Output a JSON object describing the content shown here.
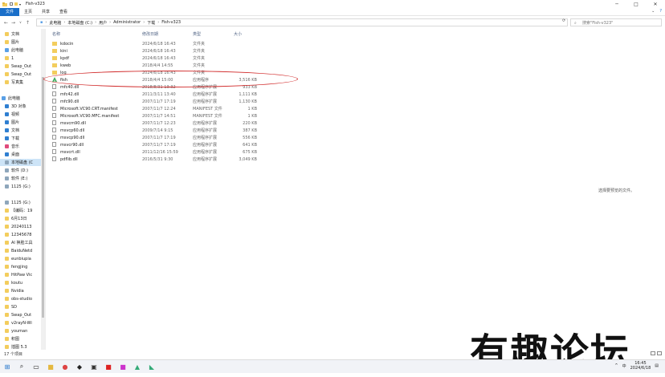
{
  "window": {
    "title": "Fish-v323",
    "controls": {
      "minimize": "─",
      "maximize": "□",
      "close": "✕"
    }
  },
  "ribbon": {
    "file_tab": "文件",
    "tabs": [
      "主页",
      "共享",
      "查看"
    ]
  },
  "address": {
    "crumbs": [
      "此电脑",
      "本地磁盘 (C:)",
      "用户",
      "Administrator",
      "下载",
      "Fish-v323"
    ],
    "search_placeholder": "搜索\"Fish-v323\""
  },
  "sidebar": {
    "items": [
      {
        "label": "文档",
        "icon": "folder"
      },
      {
        "label": "图片",
        "icon": "folder"
      },
      {
        "label": "此电脑",
        "icon": "pc"
      },
      {
        "label": "1",
        "icon": "folder"
      },
      {
        "label": "Swap_Out",
        "icon": "folder"
      },
      {
        "label": "Swap_Out",
        "icon": "folder"
      },
      {
        "label": "写真集",
        "icon": "folder"
      },
      {
        "label": "",
        "icon": ""
      },
      {
        "label": "此电脑",
        "icon": "pc"
      },
      {
        "label": "3D 对象",
        "icon": "blue"
      },
      {
        "label": "视频",
        "icon": "blue"
      },
      {
        "label": "图片",
        "icon": "blue"
      },
      {
        "label": "文档",
        "icon": "blue"
      },
      {
        "label": "下载",
        "icon": "blue"
      },
      {
        "label": "音乐",
        "icon": "music"
      },
      {
        "label": "桌面",
        "icon": "blue"
      },
      {
        "label": "本地磁盘 (C",
        "icon": "drive",
        "selected": true
      },
      {
        "label": "软件 (D:)",
        "icon": "drive"
      },
      {
        "label": "软件 (E:)",
        "icon": "drive"
      },
      {
        "label": "1125 (G:)",
        "icon": "drive"
      },
      {
        "label": "",
        "icon": ""
      },
      {
        "label": "1125 (G:)",
        "icon": "drive"
      },
      {
        "label": "【编码：19",
        "icon": "folder"
      },
      {
        "label": "6月13日",
        "icon": "folder"
      },
      {
        "label": "20240113",
        "icon": "folder"
      },
      {
        "label": "12345678",
        "icon": "folder"
      },
      {
        "label": "AI 换脸工具",
        "icon": "folder"
      },
      {
        "label": "BaiduNetd",
        "icon": "folder"
      },
      {
        "label": "eunbiupia",
        "icon": "folder"
      },
      {
        "label": "fengjing",
        "icon": "folder"
      },
      {
        "label": "HitPaw Vic",
        "icon": "folder"
      },
      {
        "label": "koutu",
        "icon": "folder"
      },
      {
        "label": "Nvidia",
        "icon": "folder"
      },
      {
        "label": "obs-studio",
        "icon": "folder"
      },
      {
        "label": "SD",
        "icon": "folder"
      },
      {
        "label": "Swap_Out",
        "icon": "folder"
      },
      {
        "label": "v2rayN-Wi",
        "icon": "folder"
      },
      {
        "label": "youman",
        "icon": "folder"
      },
      {
        "label": "积图",
        "icon": "folder"
      },
      {
        "label": "插图 5.3",
        "icon": "folder"
      }
    ]
  },
  "columns": {
    "name": "名称",
    "date": "修改日期",
    "type": "类型",
    "size": "大小"
  },
  "files": [
    {
      "name": "kdocin",
      "date": "2024/6/18 16:43",
      "type": "文件夹",
      "size": "",
      "icon": "folder"
    },
    {
      "name": "kini",
      "date": "2024/6/18 16:43",
      "type": "文件夹",
      "size": "",
      "icon": "folder"
    },
    {
      "name": "kpdf",
      "date": "2024/6/18 16:43",
      "type": "文件夹",
      "size": "",
      "icon": "folder"
    },
    {
      "name": "kweb",
      "date": "2018/4/4 14:55",
      "type": "文件夹",
      "size": "",
      "icon": "folder"
    },
    {
      "name": "log",
      "date": "2024/6/18 16:43",
      "type": "文件夹",
      "size": "",
      "icon": "folder"
    },
    {
      "name": "fish",
      "date": "2018/4/4 15:00",
      "type": "应用程序",
      "size": "3,516 KB",
      "icon": "app"
    },
    {
      "name": "mfc40.dll",
      "date": "2018/8/31 13:32",
      "type": "应用程序扩展",
      "size": "933 KB",
      "icon": "file"
    },
    {
      "name": "mfc42.dll",
      "date": "2011/3/11 13:40",
      "type": "应用程序扩展",
      "size": "1,111 KB",
      "icon": "file"
    },
    {
      "name": "mfc90.dll",
      "date": "2007/11/7 17:19",
      "type": "应用程序扩展",
      "size": "1,130 KB",
      "icon": "file"
    },
    {
      "name": "Microsoft.VC90.CRT.manifest",
      "date": "2007/11/7 12:24",
      "type": "MANIFEST 文件",
      "size": "1 KB",
      "icon": "file"
    },
    {
      "name": "Microsoft.VC90.MFC.manifest",
      "date": "2007/11/7 14:51",
      "type": "MANIFEST 文件",
      "size": "1 KB",
      "icon": "file"
    },
    {
      "name": "msvcm90.dll",
      "date": "2007/11/7 12:23",
      "type": "应用程序扩展",
      "size": "220 KB",
      "icon": "file"
    },
    {
      "name": "msvcp60.dll",
      "date": "2009/7/14 9:15",
      "type": "应用程序扩展",
      "size": "387 KB",
      "icon": "file"
    },
    {
      "name": "msvcp90.dll",
      "date": "2007/11/7 17:19",
      "type": "应用程序扩展",
      "size": "556 KB",
      "icon": "file"
    },
    {
      "name": "msvcr90.dll",
      "date": "2007/11/7 17:19",
      "type": "应用程序扩展",
      "size": "641 KB",
      "icon": "file"
    },
    {
      "name": "msvcrt.dll",
      "date": "2011/12/16 15:59",
      "type": "应用程序扩展",
      "size": "675 KB",
      "icon": "file"
    },
    {
      "name": "pdflib.dll",
      "date": "2016/5/31 9:30",
      "type": "应用程序扩展",
      "size": "3,049 KB",
      "icon": "file"
    }
  ],
  "preview_text": "选择要预览的文件。",
  "status_text": "17 个项目",
  "watermark": "有趣论坛",
  "taskbar": {
    "ime": "中",
    "time": "16:45",
    "date": "2024/6/18"
  },
  "colors": {
    "accent": "#1a6fc9",
    "annotation": "#d12a2a",
    "folder": "#f3cd5d"
  }
}
